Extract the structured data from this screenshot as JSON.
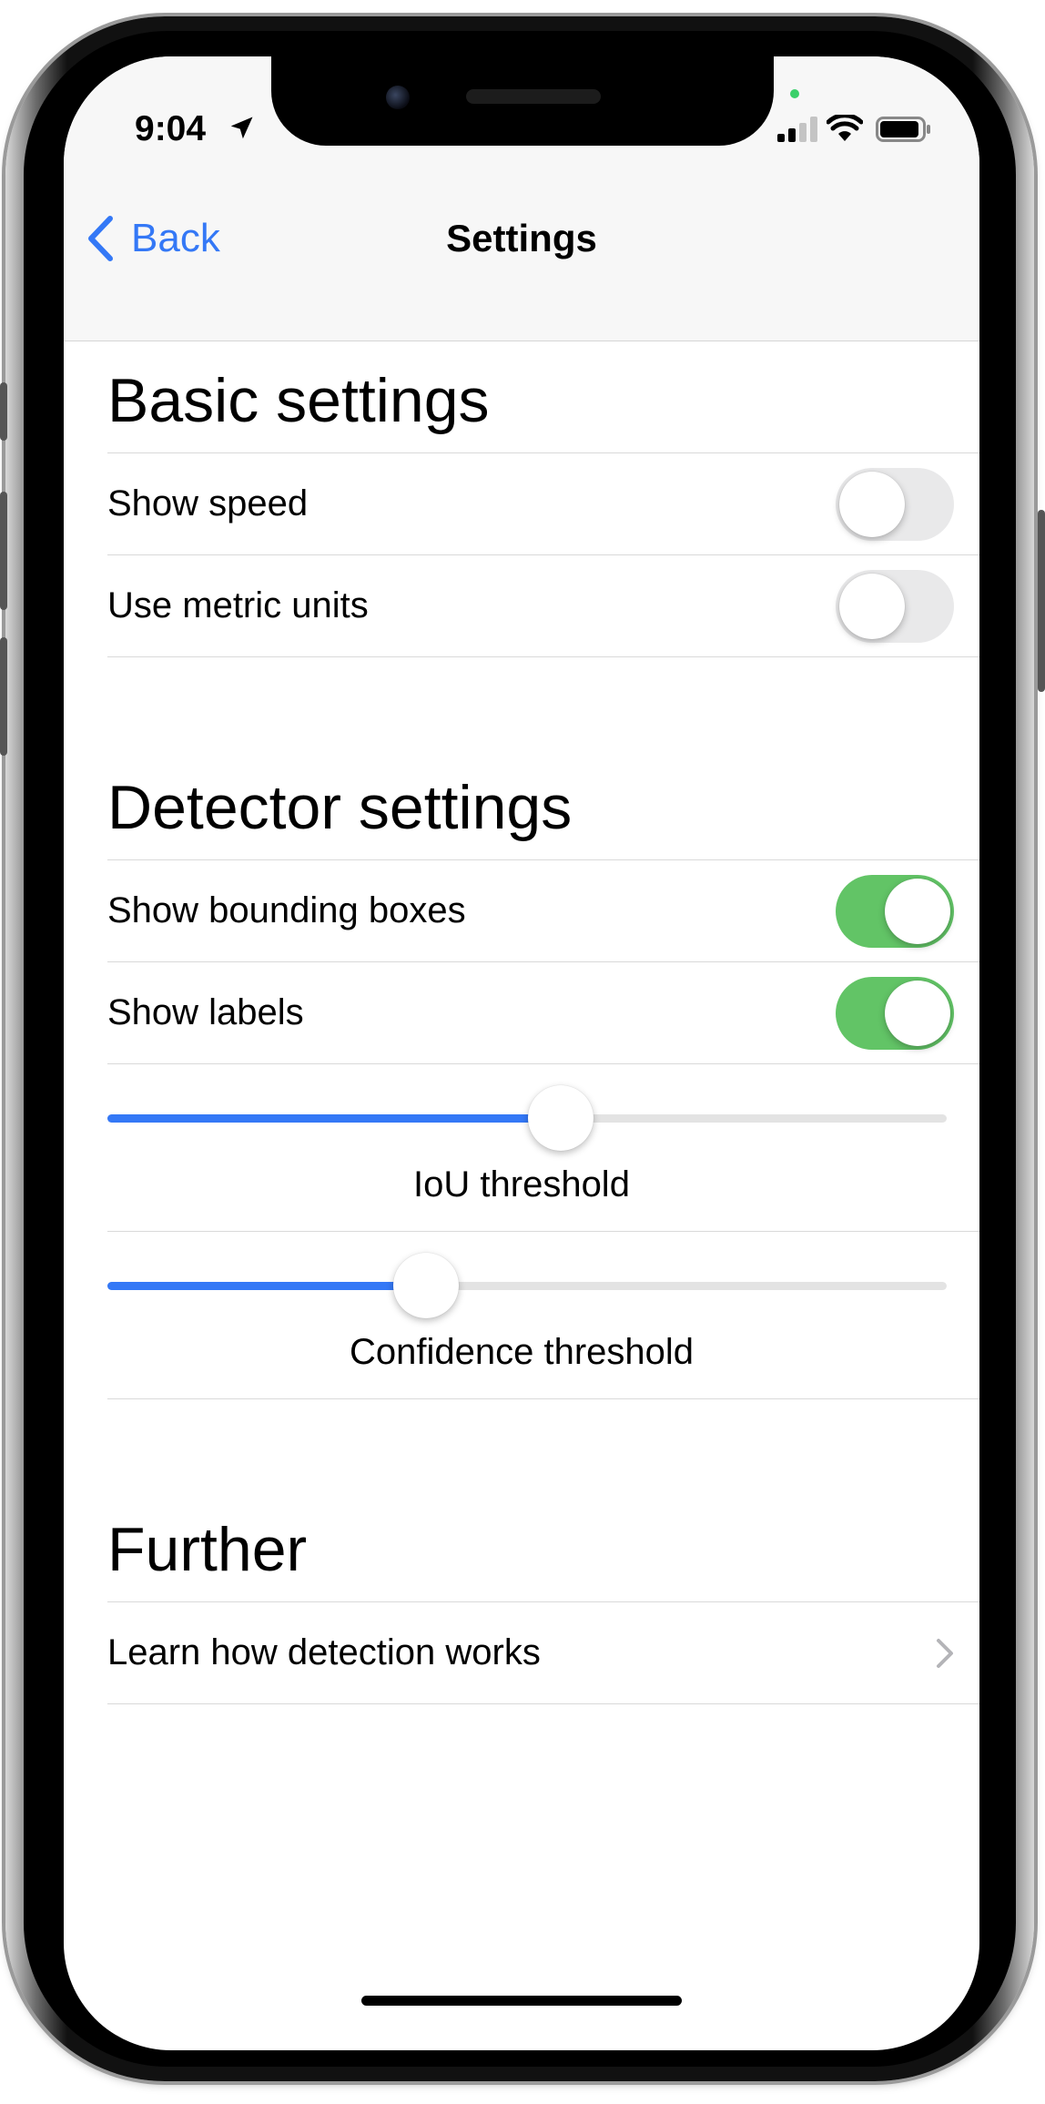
{
  "status_bar": {
    "time": "9:04"
  },
  "nav": {
    "back_label": "Back",
    "title": "Settings"
  },
  "sections": {
    "basic": {
      "header": "Basic settings",
      "rows": [
        {
          "label": "Show speed",
          "on": false
        },
        {
          "label": "Use metric units",
          "on": false
        }
      ]
    },
    "detector": {
      "header": "Detector settings",
      "rows": [
        {
          "label": "Show bounding boxes",
          "on": true
        },
        {
          "label": "Show labels",
          "on": true
        }
      ],
      "sliders": [
        {
          "caption": "IoU threshold",
          "value": 0.54
        },
        {
          "caption": "Confidence threshold",
          "value": 0.38
        }
      ]
    },
    "further": {
      "header": "Further",
      "rows": [
        {
          "label": "Learn how detection works"
        }
      ]
    }
  },
  "colors": {
    "accent": "#3478f6",
    "toggle_on": "#62c466",
    "toggle_off": "#e9e9ea"
  }
}
